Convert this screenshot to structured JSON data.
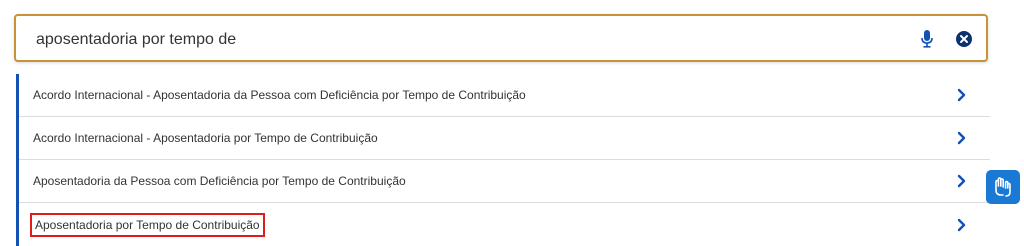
{
  "search": {
    "value": "aposentadoria por tempo de",
    "mic_icon": "microphone-icon",
    "clear_icon": "close-circle-icon"
  },
  "results": [
    {
      "label": "Acordo Internacional - Aposentadoria da Pessoa com Deficiência por Tempo de Contribuição",
      "highlighted": false
    },
    {
      "label": "Acordo Internacional - Aposentadoria por Tempo de Contribuição",
      "highlighted": false
    },
    {
      "label": "Aposentadoria da Pessoa com Deficiência por Tempo de Contribuição",
      "highlighted": false
    },
    {
      "label": "Aposentadoria por Tempo de Contribuição",
      "highlighted": true
    }
  ],
  "accessibility": {
    "icon": "sign-language-hands-icon"
  },
  "colors": {
    "search_border": "#c7923a",
    "accent_blue": "#1351b4",
    "highlight_red": "#e01b1b",
    "vlibras_bg": "#1b79d6"
  }
}
